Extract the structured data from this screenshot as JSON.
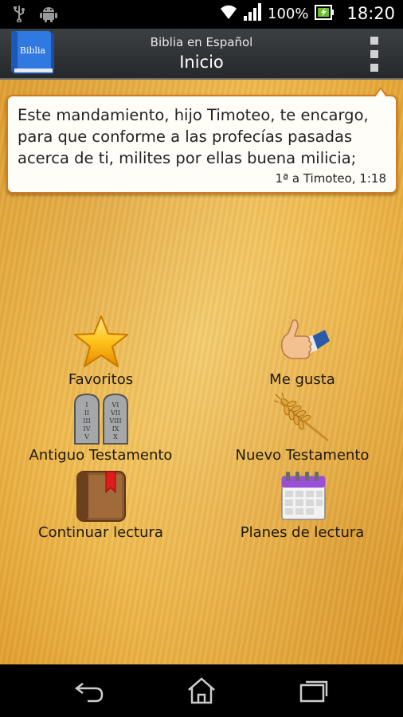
{
  "status_bar": {
    "battery_percent": "100%",
    "time": "18:20",
    "icons": [
      "usb-icon",
      "android-icon",
      "wifi-icon",
      "signal-icon",
      "battery-charging-icon"
    ]
  },
  "action_bar": {
    "logo_text": "Biblia",
    "subtitle": "Biblia en Español",
    "title": "Inicio"
  },
  "verse": {
    "text": "Este mandamiento, hijo Timoteo, te encargo, para que conforme a las profecías pasadas acerca de ti, milites por ellas buena milicia;",
    "reference": "1ª a Timoteo, 1:18"
  },
  "menu": {
    "items": [
      {
        "label": "Favoritos",
        "icon": "star-icon"
      },
      {
        "label": "Me gusta",
        "icon": "thumbs-up-icon"
      },
      {
        "label": "Antiguo Testamento",
        "icon": "stone-tablets-icon"
      },
      {
        "label": "Nuevo Testamento",
        "icon": "wheat-icon"
      },
      {
        "label": "Continuar lectura",
        "icon": "bookmark-book-icon"
      },
      {
        "label": "Planes de lectura",
        "icon": "calendar-icon"
      }
    ]
  },
  "tablets": {
    "left": [
      "I",
      "II",
      "III",
      "IV",
      "V"
    ],
    "right": [
      "VI",
      "VII",
      "VIII",
      "IX",
      "X"
    ]
  },
  "colors": {
    "card_border": "#d67a1e",
    "parchment": "#f0bb4f",
    "action_bar": "#2e3133"
  }
}
